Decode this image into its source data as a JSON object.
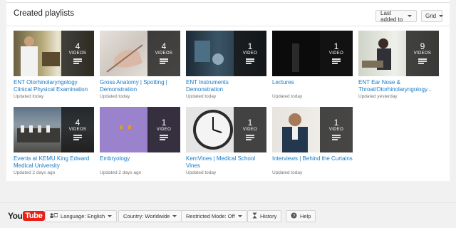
{
  "header": {
    "title": "Created playlists",
    "sort_label": "Last added to",
    "view_label": "Grid"
  },
  "playlists": [
    {
      "title": "ENT Otorhinolaryngology Clinical Physical Examination by Dr...",
      "count": "4",
      "unit": "VIDEOS",
      "updated": "Updated today"
    },
    {
      "title": "Gross Anatomy | Spotting | Demonstration",
      "count": "4",
      "unit": "VIDEOS",
      "updated": "Updated today"
    },
    {
      "title": "ENT Instruments Demonstration",
      "count": "1",
      "unit": "VIDEO",
      "updated": "Updated today"
    },
    {
      "title": "Lectures",
      "count": "1",
      "unit": "VIDEO",
      "updated": "Updated today"
    },
    {
      "title": "ENT Ear Nose & Throat/Otorhinolaryngology...",
      "count": "9",
      "unit": "VIDEOS",
      "updated": "Updated yesterday"
    },
    {
      "title": "Events at KEMU King Edward Medical University",
      "count": "4",
      "unit": "VIDEOS",
      "updated": "Updated 2 days ago"
    },
    {
      "title": "Embryology",
      "count": "1",
      "unit": "VIDEO",
      "updated": "Updated 2 days ago"
    },
    {
      "title": "KemVines | Medical School Vines",
      "count": "1",
      "unit": "VIDEO",
      "updated": "Updated today"
    },
    {
      "title": "Interviews | Behind the Curtains",
      "count": "1",
      "unit": "VIDEO",
      "updated": "Updated today"
    }
  ],
  "footer": {
    "logo_you": "You",
    "logo_tube": "Tube",
    "language": "Language: English",
    "country": "Country: Worldwide",
    "restricted": "Restricted Mode: Off",
    "history": "History",
    "help": "Help"
  },
  "colors": {
    "link": "#167ac6",
    "brand_red": "#e62117"
  }
}
